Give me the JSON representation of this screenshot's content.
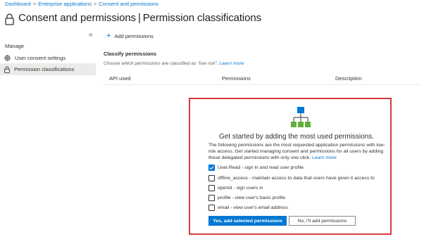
{
  "breadcrumb": {
    "items": [
      "Dashboard",
      "Enterprise applications",
      "Consent and permissions"
    ],
    "separator": ">"
  },
  "header": {
    "title": "Consent and permissions",
    "separator": "|",
    "subtitle": "Permission classifications",
    "icon": "lock-icon"
  },
  "sidebar": {
    "collapse_glyph": "«",
    "section_label": "Manage",
    "items": [
      {
        "label": "User consent settings",
        "icon": "gear-icon",
        "active": false
      },
      {
        "label": "Permission classifications",
        "icon": "lock-icon",
        "active": true
      }
    ]
  },
  "toolbar": {
    "add_label": "Add permissions"
  },
  "main": {
    "section_title": "Classify permissions",
    "description": "Choose which permissions are classified as \"low risk\".",
    "learn_more": "Learn more",
    "columns": [
      "API used",
      "Permissions",
      "Description"
    ]
  },
  "empty_state": {
    "icon": "hierarchy-icon",
    "title": "Get started by adding the most used permissions.",
    "description": "The following permissions are the most requested application permissions with low-risk access. Get started managing consent and permissions for all users by adding these delegated permissions with only one click.",
    "learn_more": "Learn more",
    "options": [
      {
        "label": "User.Read - sign in and read user profile",
        "checked": true
      },
      {
        "label": "offline_access - maintain access to data that users have given it access to",
        "checked": false
      },
      {
        "label": "openid - sign users in",
        "checked": false
      },
      {
        "label": "profile - view user's basic profile",
        "checked": false
      },
      {
        "label": "email - view user's email address",
        "checked": false
      }
    ],
    "primary_button": "Yes, add selected permissions",
    "secondary_button": "No, I'll add permissions"
  },
  "colors": {
    "accent": "#0078d4",
    "highlight_border": "#d9393e",
    "active_nav": "#edebe9"
  }
}
